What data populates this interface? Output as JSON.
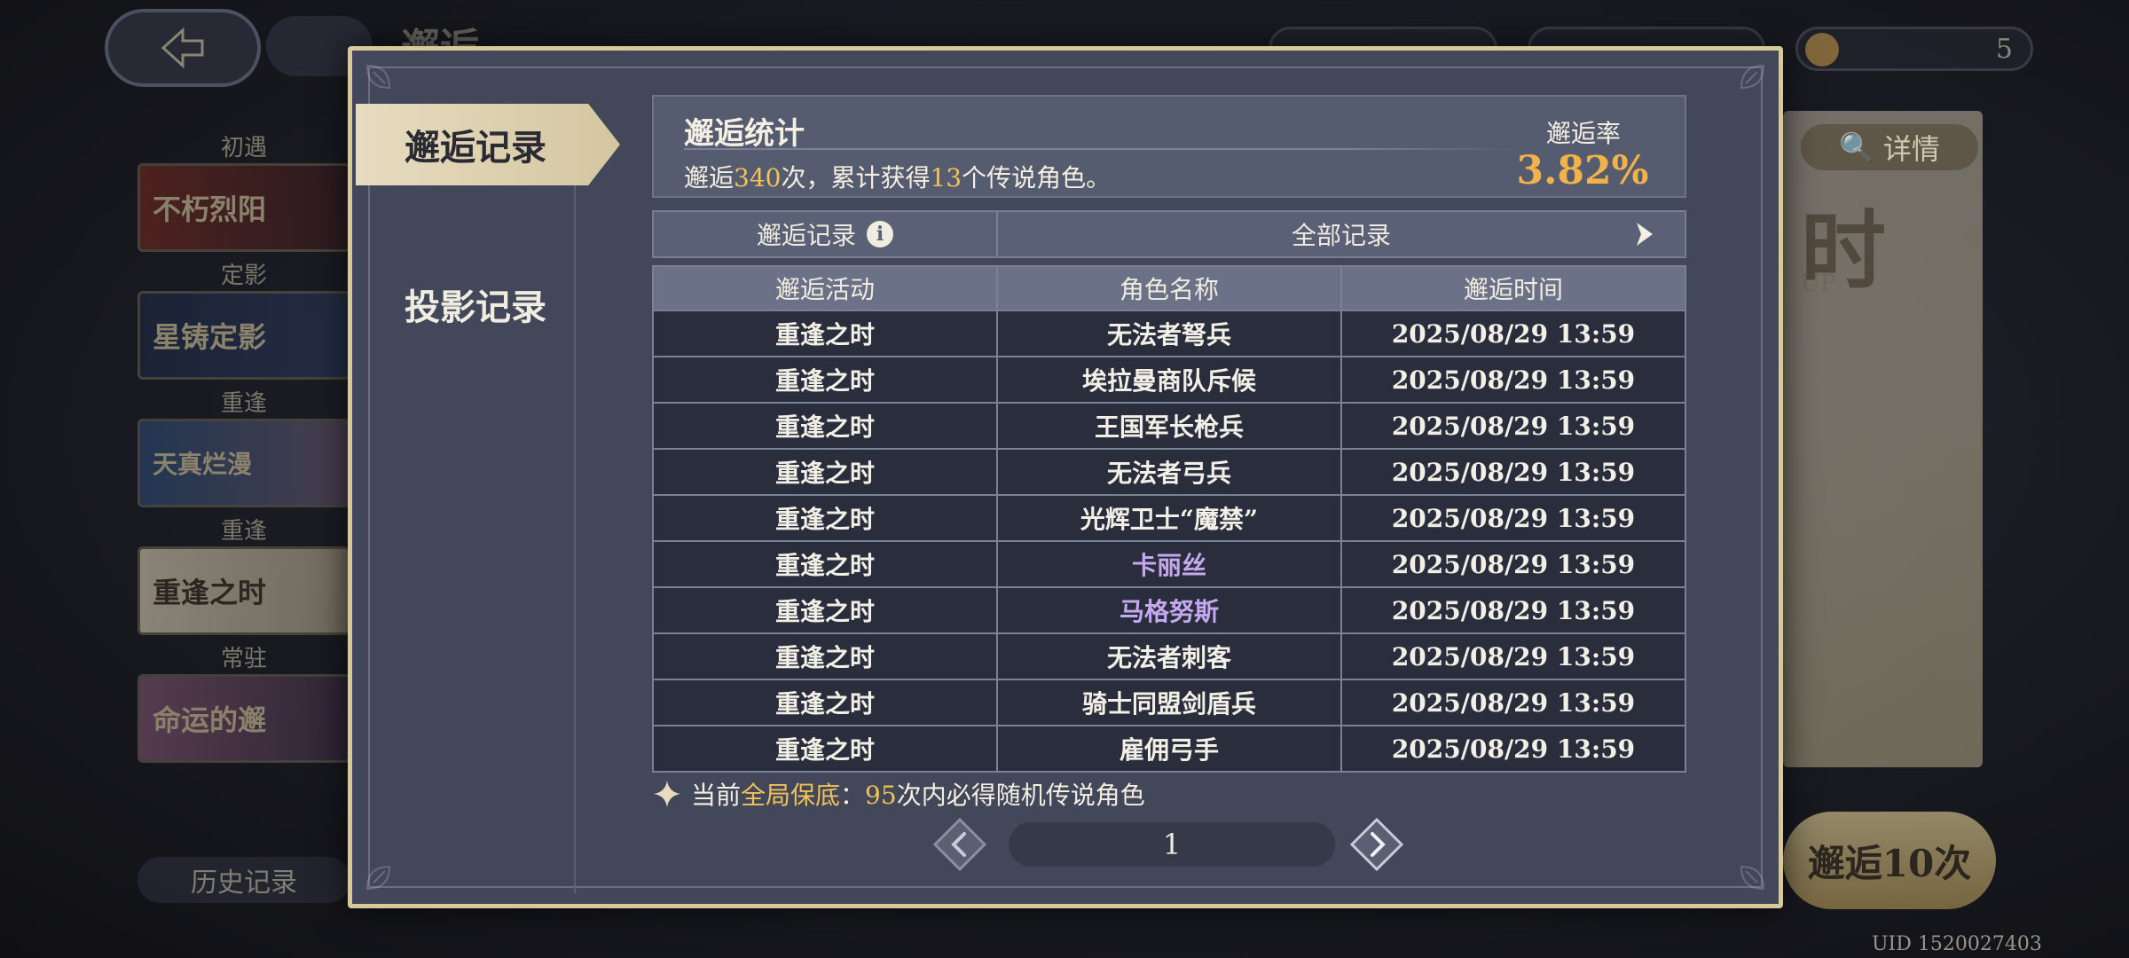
{
  "background": {
    "top_title": "邂逅",
    "currency_amount": "5",
    "banner_categories": [
      "初遇",
      "定影",
      "重逢",
      "重逢",
      "常驻"
    ],
    "banner_names": [
      "不朽烈阳",
      "星铸定影",
      "天真烂漫",
      "重逢之时",
      "命运的邂"
    ],
    "history_button": "历史记录",
    "detail_button": "详情",
    "right_big_char": "时",
    "right_up_text": "UP",
    "draw10_button": "邂逅10次",
    "uid": "UID 1520027403"
  },
  "modal": {
    "tabs": {
      "active": "邂逅记录",
      "inactive": "投影记录"
    },
    "stats": {
      "title": "邂逅统计",
      "desc_prefix": "邂逅",
      "total_draws": "340",
      "desc_mid": "次，累计获得",
      "legendary_count": "13",
      "desc_suffix": "个传说角色。",
      "rate_label": "邂逅率",
      "rate_value": "3.82%"
    },
    "filter": {
      "label": "邂逅记录",
      "info_icon": "i",
      "selected": "全部记录"
    },
    "table": {
      "headers": [
        "邂逅活动",
        "角色名称",
        "邂逅时间"
      ],
      "rows": [
        {
          "activity": "重逢之时",
          "name": "无法者弩兵",
          "time": "2025/08/29 13:59",
          "rarity": "normal"
        },
        {
          "activity": "重逢之时",
          "name": "埃拉曼商队斥候",
          "time": "2025/08/29 13:59",
          "rarity": "normal"
        },
        {
          "activity": "重逢之时",
          "name": "王国军长枪兵",
          "time": "2025/08/29 13:59",
          "rarity": "normal"
        },
        {
          "activity": "重逢之时",
          "name": "无法者弓兵",
          "time": "2025/08/29 13:59",
          "rarity": "normal"
        },
        {
          "activity": "重逢之时",
          "name": "光辉卫士“魔禁”",
          "time": "2025/08/29 13:59",
          "rarity": "normal"
        },
        {
          "activity": "重逢之时",
          "name": "卡丽丝",
          "time": "2025/08/29 13:59",
          "rarity": "rare"
        },
        {
          "activity": "重逢之时",
          "name": "马格努斯",
          "time": "2025/08/29 13:59",
          "rarity": "rare"
        },
        {
          "activity": "重逢之时",
          "name": "无法者刺客",
          "time": "2025/08/29 13:59",
          "rarity": "normal"
        },
        {
          "activity": "重逢之时",
          "name": "骑士同盟剑盾兵",
          "time": "2025/08/29 13:59",
          "rarity": "normal"
        },
        {
          "activity": "重逢之时",
          "name": "雇佣弓手",
          "time": "2025/08/29 13:59",
          "rarity": "normal"
        }
      ]
    },
    "pity": {
      "prefix": "当前",
      "highlight": "全局保底",
      "colon": "：",
      "count": "95",
      "suffix": "次内必得随机传说角色"
    },
    "pagination": {
      "current_page": "1"
    },
    "colors": {
      "accent_gold": "#f2c15a",
      "rate_orange": "#f2b24a",
      "rare_purple": "#c4a8f0",
      "frame_gold": "#d8c99a"
    }
  }
}
